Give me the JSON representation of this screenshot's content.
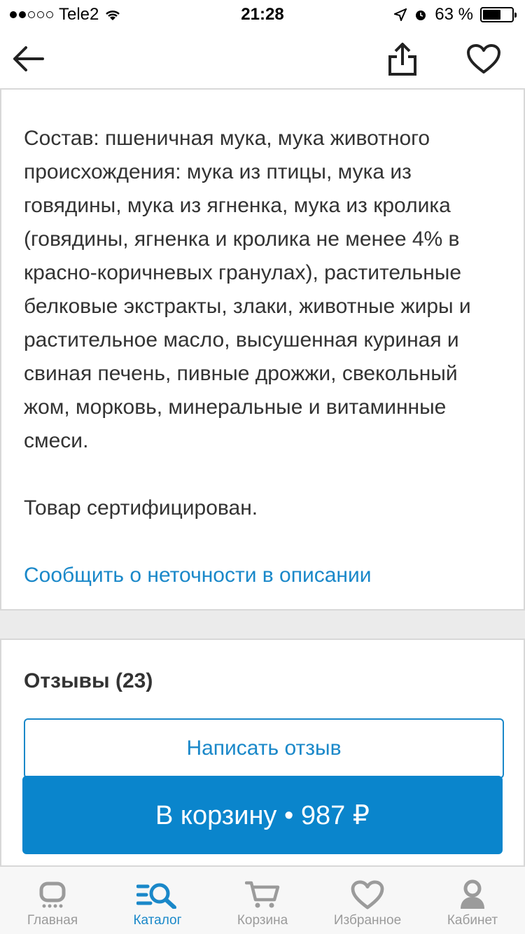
{
  "status_bar": {
    "carrier": "Tele2",
    "time": "21:28",
    "battery_percent": "63 %",
    "battery_level": 0.63
  },
  "nav": {
    "back_icon": "arrow-left-icon",
    "share_icon": "share-icon",
    "favorite_icon": "heart-icon"
  },
  "description": {
    "composition": "Состав: пшеничная мука, мука животного происхождения: мука из птицы, мука из говядины, мука из ягненка, мука из кролика (говядины, ягненка и кролика не менее 4% в красно-коричневых гранулах), растительные белковые экстракты, злаки, животные жиры и растительное масло, высушенная куриная и свиная печень, пивные дрожжи, свекольный жом, морковь, минеральные и витаминные смеси.",
    "certified": "Товар сертифицирован.",
    "report_link": "Сообщить о неточности в описании"
  },
  "reviews": {
    "title": "Отзывы (23)",
    "write_button": "Написать отзыв"
  },
  "cart_button": "В корзину • 987 ₽",
  "tabs": [
    {
      "label": "Главная",
      "icon": "home-icon",
      "active": false
    },
    {
      "label": "Каталог",
      "icon": "catalog-search-icon",
      "active": true
    },
    {
      "label": "Корзина",
      "icon": "cart-icon",
      "active": false
    },
    {
      "label": "Избранное",
      "icon": "heart-icon",
      "active": false
    },
    {
      "label": "Кабинет",
      "icon": "user-icon",
      "active": false
    }
  ],
  "colors": {
    "accent": "#1a88c9",
    "cart_button": "#0a85cc",
    "inactive_tab": "#9b9b9b"
  }
}
